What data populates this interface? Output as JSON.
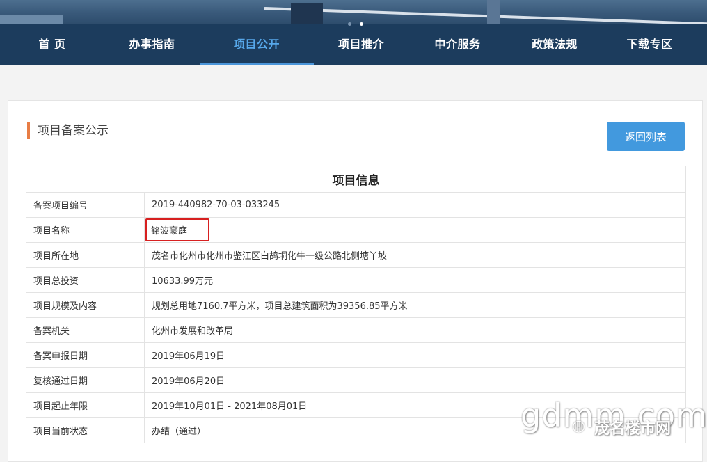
{
  "nav": {
    "items": [
      {
        "label": "首 页",
        "active": false
      },
      {
        "label": "办事指南",
        "active": false
      },
      {
        "label": "项目公开",
        "active": true
      },
      {
        "label": "项目推介",
        "active": false
      },
      {
        "label": "中介服务",
        "active": false
      },
      {
        "label": "政策法规",
        "active": false
      },
      {
        "label": "下载专区",
        "active": false
      }
    ]
  },
  "section": {
    "title": "项目备案公示",
    "back_button": "返回列表"
  },
  "table": {
    "header": "项目信息",
    "rows": [
      {
        "label": "备案项目编号",
        "value": "2019-440982-70-03-033245"
      },
      {
        "label": "项目名称",
        "value": "铭波豪庭"
      },
      {
        "label": "项目所在地",
        "value": "茂名市化州市化州市鉴江区白鸪垌化牛一级公路北侧塘丫坡"
      },
      {
        "label": "项目总投资",
        "value": "10633.99万元"
      },
      {
        "label": "项目规模及内容",
        "value": "规划总用地7160.7平方米，项目总建筑面积为39356.85平方米"
      },
      {
        "label": "备案机关",
        "value": "化州市发展和改革局"
      },
      {
        "label": "备案申报日期",
        "value": "2019年06月19日"
      },
      {
        "label": "复核通过日期",
        "value": "2019年06月20日"
      },
      {
        "label": "项目起止年限",
        "value": "2019年10月01日 - 2021年08月01日"
      },
      {
        "label": "项目当前状态",
        "value": "办结（通过）"
      }
    ]
  },
  "watermark": {
    "url": "gdmm.com",
    "name": "茂名楼市网",
    "icon": "wechat-icon"
  },
  "colors": {
    "nav_bg": "#1c3c5d",
    "nav_active": "#57a8ea",
    "accent_bar": "#e87d45",
    "button": "#4299de",
    "highlight_box": "#d72020"
  }
}
